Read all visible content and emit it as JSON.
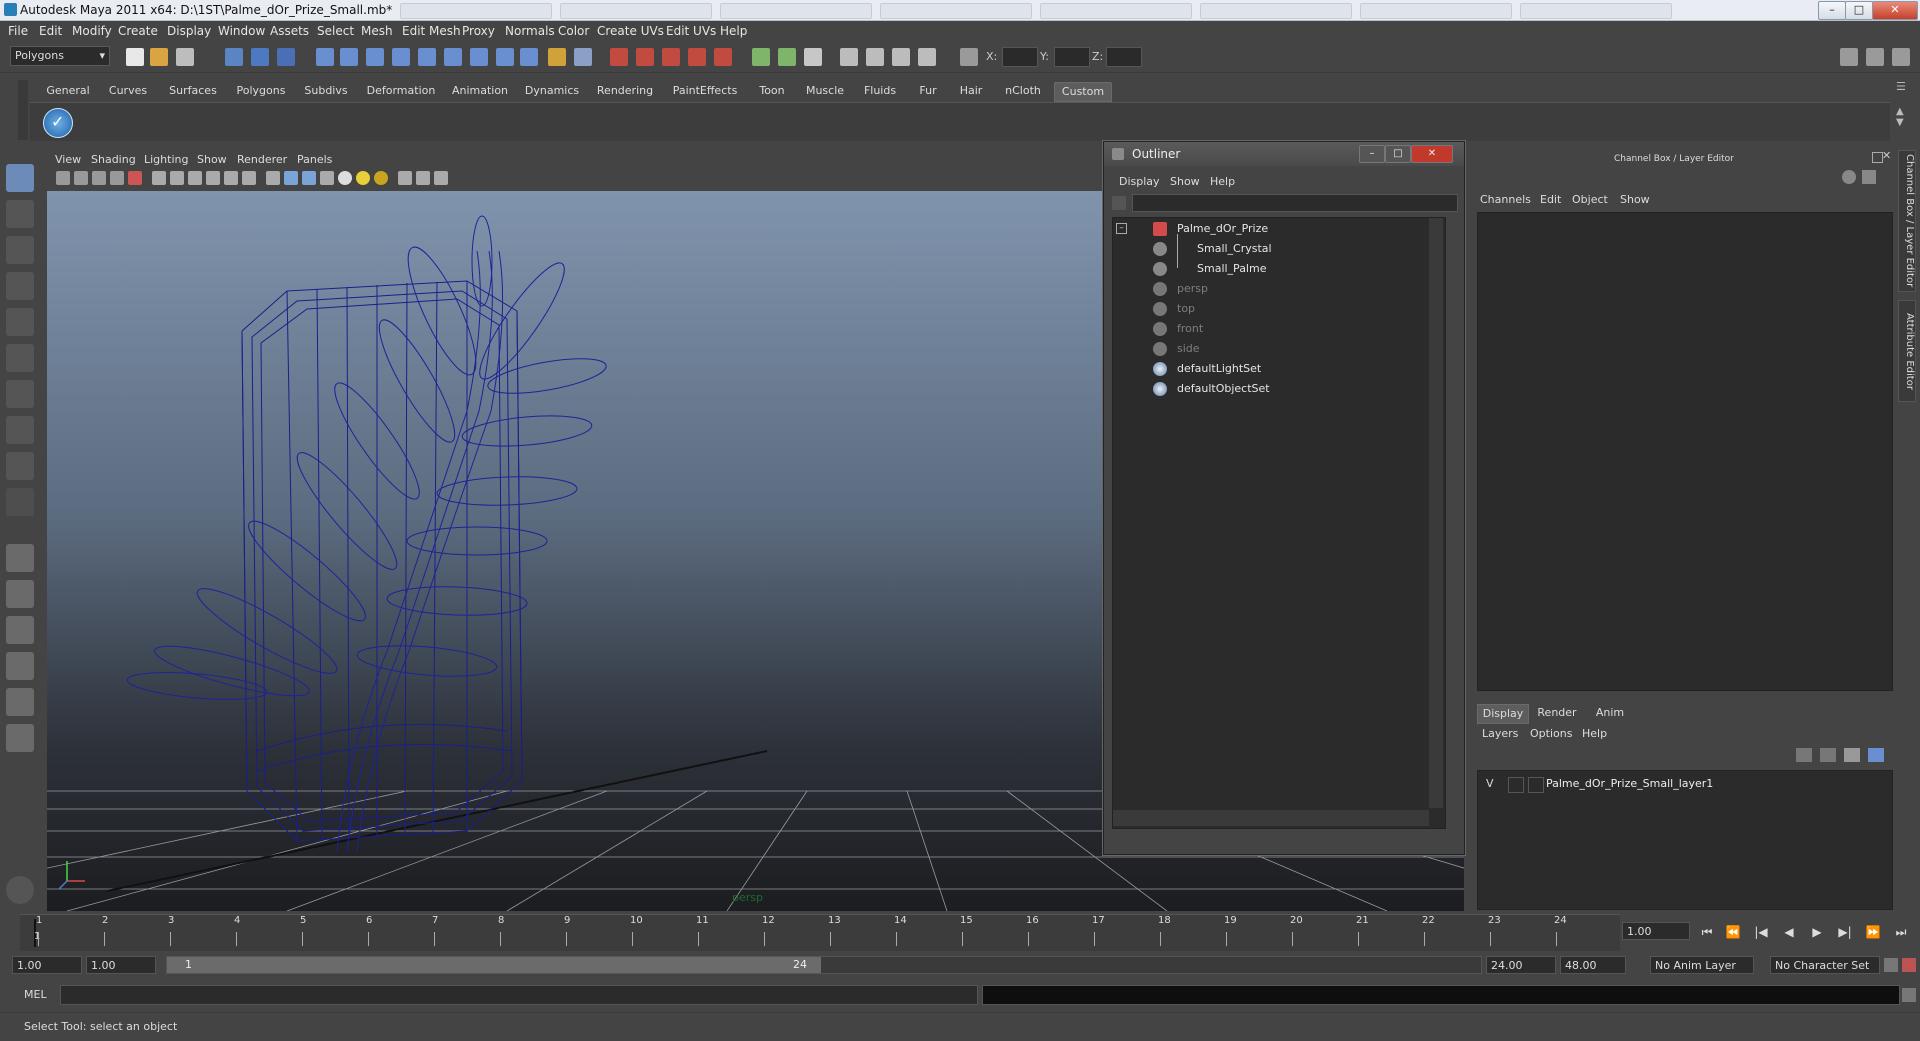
{
  "window": {
    "title": "Autodesk Maya 2011 x64: D:\\1ST\\Palme_dOr_Prize_Small.mb*",
    "minimize": "–",
    "maximize": "□",
    "close": "✕"
  },
  "menubar": [
    "File",
    "Edit",
    "Modify",
    "Create",
    "Display",
    "Window",
    "Assets",
    "Select",
    "Mesh",
    "Edit Mesh",
    "Proxy",
    "Normals",
    "Color",
    "Create UVs",
    "Edit UVs",
    "Help"
  ],
  "statusline": {
    "mode": "Polygons",
    "x_label": "X:",
    "y_label": "Y:",
    "z_label": "Z:"
  },
  "shelf": {
    "tabs": [
      "General",
      "Curves",
      "Surfaces",
      "Polygons",
      "Subdivs",
      "Deformation",
      "Animation",
      "Dynamics",
      "Rendering",
      "PaintEffects",
      "Toon",
      "Muscle",
      "Fluids",
      "Fur",
      "Hair",
      "nCloth",
      "Custom"
    ],
    "active": "Custom"
  },
  "viewport": {
    "menus": [
      "View",
      "Shading",
      "Lighting",
      "Show",
      "Renderer",
      "Panels"
    ],
    "camera_label": "persp"
  },
  "outliner": {
    "title": "Outliner",
    "menus": [
      "Display",
      "Show",
      "Help"
    ],
    "items": [
      {
        "label": "Palme_dOr_Prize",
        "dim": false
      },
      {
        "label": "Small_Crystal",
        "dim": false
      },
      {
        "label": "Small_Palme",
        "dim": false
      },
      {
        "label": "persp",
        "dim": true
      },
      {
        "label": "top",
        "dim": true
      },
      {
        "label": "front",
        "dim": true
      },
      {
        "label": "side",
        "dim": true
      },
      {
        "label": "defaultLightSet",
        "dim": false
      },
      {
        "label": "defaultObjectSet",
        "dim": false
      }
    ]
  },
  "channelbox": {
    "title": "Channel Box / Layer Editor",
    "menus": [
      "Channels",
      "Edit",
      "Object",
      "Show"
    ],
    "layer_tabs": [
      "Display",
      "Render",
      "Anim"
    ],
    "layer_menus": [
      "Layers",
      "Options",
      "Help"
    ],
    "layer_row": {
      "visibility": "V",
      "name": "Palme_dOr_Prize_Small_layer1"
    },
    "side_tabs": [
      "Channel Box / Layer Editor",
      "Attribute Editor"
    ]
  },
  "timeslider": {
    "ticks": [
      "1",
      "2",
      "3",
      "4",
      "5",
      "6",
      "7",
      "8",
      "9",
      "10",
      "11",
      "12",
      "13",
      "14",
      "15",
      "16",
      "17",
      "18",
      "19",
      "20",
      "21",
      "22",
      "23",
      "24"
    ],
    "current_frame_marker": "1",
    "current_time": "1.00"
  },
  "playback": [
    "⏮",
    "⏪",
    "|◀",
    "◀",
    "▶",
    "▶|",
    "⏩",
    "⏭"
  ],
  "range": {
    "start": "1.00",
    "start2": "1.00",
    "slider_start": "1",
    "slider_end": "24",
    "end": "24.00",
    "end2": "48.00",
    "anim_layer": "No Anim Layer",
    "char_set": "No Character Set"
  },
  "command": {
    "label": "MEL"
  },
  "helpline": {
    "text": "Select Tool: select an object"
  },
  "colors": {
    "wire": "#1a1f8a",
    "panel": "#444444",
    "field": "#2b2b2b"
  }
}
